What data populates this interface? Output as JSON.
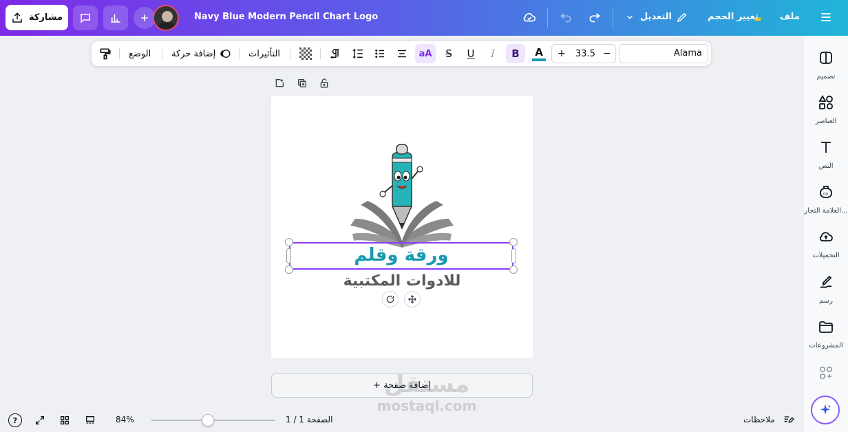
{
  "header": {
    "share_label": "مشاركة",
    "design_title": "Navy Blue Modern Pencil Chart Logo",
    "edit_label": "التعديل",
    "resize_label": "تغيير الحجم",
    "file_label": "ملف"
  },
  "toolbar": {
    "font_name": "Alama",
    "font_size": "33.5",
    "minus_label": "−",
    "plus_label": "+",
    "bold_label": "B",
    "italic_label": "I",
    "underline_label": "U",
    "strike_label": "S",
    "case_label": "aA",
    "color_label": "A",
    "effects_label": "التأثيرات",
    "animate_label": "إضافة حركة",
    "position_label": "الوضع"
  },
  "sidebar": {
    "items": [
      {
        "label": "تصميم",
        "icon": "layout-icon"
      },
      {
        "label": "العناصر",
        "icon": "elements-icon"
      },
      {
        "label": "النص",
        "icon": "text-icon"
      },
      {
        "label": "العلامة التجار...",
        "icon": "brand-icon"
      },
      {
        "label": "التحميلات",
        "icon": "upload-icon"
      },
      {
        "label": "رسم",
        "icon": "draw-icon"
      },
      {
        "label": "المشروعات",
        "icon": "folder-icon"
      }
    ]
  },
  "canvas": {
    "logo_line1": "ورقة وقلم",
    "logo_line2": "للادوات المكتبية",
    "add_page_label": "+ إضافة صفحة"
  },
  "bottom": {
    "notes_label": "ملاحظات",
    "page_label": "الصفحة 1 / 1",
    "zoom_label": "84%",
    "help_label": "?"
  },
  "watermark": {
    "text_ar": "مستقل",
    "text_en": "mostaql.com"
  },
  "colors": {
    "accent": "#8b3dff",
    "logo_teal": "#1a9ab0",
    "logo_gray": "#5a5a5a"
  }
}
